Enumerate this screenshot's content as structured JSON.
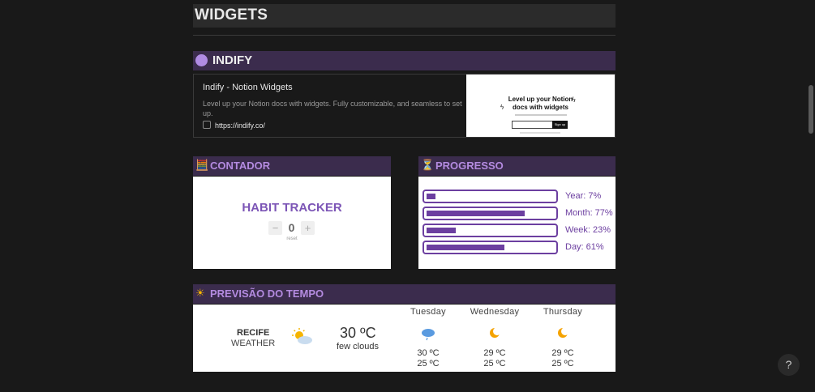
{
  "page": {
    "title": "WIDGETS"
  },
  "indify": {
    "header": "INDIFY",
    "bookmark": {
      "title": "Indify - Notion Widgets",
      "description": "Level up your Notion docs with widgets. Fully customizable, and seamless to set up.",
      "url": "https://indify.co/",
      "preview_heading_1": "Level up your Notion",
      "preview_heading_2": "docs with widgets",
      "preview_button": "Sign up"
    }
  },
  "contador": {
    "header": "CONTADOR",
    "icon": "abacus-icon",
    "title": "HABIT TRACKER",
    "minus": "−",
    "count": "0",
    "plus": "+",
    "reset": "reset"
  },
  "progresso": {
    "header": "PROGRESSO",
    "icon": "hourglass-icon",
    "bars": [
      {
        "label": "Year: 7%",
        "value": 0.07
      },
      {
        "label": "Month: 77%",
        "value": 0.77
      },
      {
        "label": "Week: 23%",
        "value": 0.23
      },
      {
        "label": "Day: 61%",
        "value": 0.61
      }
    ],
    "color": "#6c3fa0"
  },
  "tempo": {
    "header": "PREVISÃO DO TEMPO",
    "icon": "sun-icon",
    "city": "RECIFE",
    "subtitle": "WEATHER",
    "current_temp": "30 ºC",
    "current_desc": "few clouds",
    "forecast": [
      {
        "day": "Tuesday",
        "icon": "rain-cloud-icon",
        "high": "30 ºC",
        "low": "25 ºC"
      },
      {
        "day": "Wednesday",
        "icon": "moon-icon",
        "high": "29 ºC",
        "low": "25 ºC"
      },
      {
        "day": "Thursday",
        "icon": "moon-icon",
        "high": "29 ºC",
        "low": "25 ºC"
      }
    ]
  },
  "help": {
    "label": "?"
  },
  "colors": {
    "accent": "#b48be0",
    "section_bg": "#3b2c4d",
    "background": "#191919"
  }
}
